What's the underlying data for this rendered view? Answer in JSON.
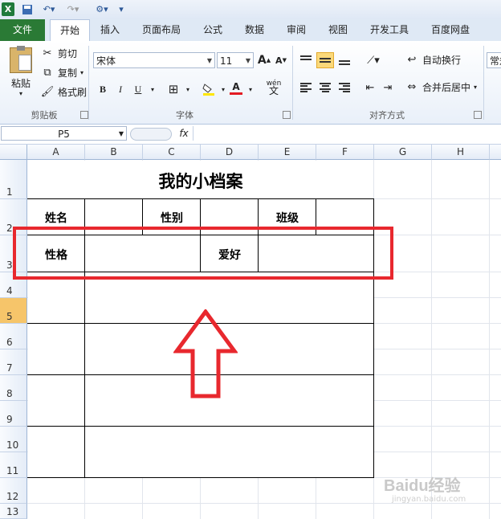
{
  "qat": {
    "icons": [
      "excel-logo-icon",
      "save-icon",
      "undo-icon",
      "redo-icon",
      "customize-icon"
    ]
  },
  "tabs": {
    "file": "文件",
    "items": [
      "开始",
      "插入",
      "页面布局",
      "公式",
      "数据",
      "审阅",
      "视图",
      "开发工具",
      "百度网盘"
    ]
  },
  "clipboard": {
    "paste": "粘贴",
    "cut": "剪切",
    "copy": "复制",
    "format_painter": "格式刷",
    "group": "剪贴板"
  },
  "font": {
    "name": "宋体",
    "size": "11",
    "grow": "A",
    "shrink": "A",
    "bold": "B",
    "italic": "I",
    "underline": "U",
    "font_color": "A",
    "phonetic": "wén",
    "group": "字体"
  },
  "alignment": {
    "wrap": "自动换行",
    "merge": "合并后居中",
    "group": "对齐方式"
  },
  "number": {
    "format": "常规"
  },
  "formula": {
    "name_box": "P5",
    "fx": "fx",
    "value": ""
  },
  "columns": [
    "A",
    "B",
    "C",
    "D",
    "E",
    "F",
    "G",
    "H"
  ],
  "rows": [
    "1",
    "2",
    "3",
    "4",
    "5",
    "6",
    "7",
    "8",
    "9",
    "10",
    "11",
    "12",
    "13"
  ],
  "selected_row": "5",
  "sheet": {
    "title": "我的小档案",
    "labels": {
      "name": "姓名",
      "gender": "性别",
      "class": "班级",
      "personality": "性格",
      "hobby": "爱好"
    }
  },
  "annotation": {
    "highlight_color": "#e8282e",
    "arrow_color": "#e8282e"
  },
  "watermark": {
    "text": "Baidu经验",
    "url": "jingyan.baidu.com"
  }
}
